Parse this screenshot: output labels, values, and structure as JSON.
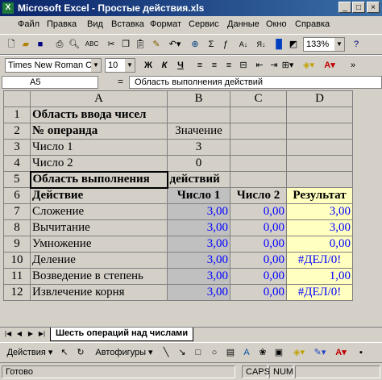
{
  "window": {
    "title": "Microsoft Excel - Простые действия.xls",
    "icon": "X",
    "buttons": [
      "_",
      "□",
      "×"
    ]
  },
  "menu": [
    "Файл",
    "Правка",
    "Вид",
    "Вставка",
    "Формат",
    "Сервис",
    "Данные",
    "Окно",
    "Справка"
  ],
  "standard_toolbar": {
    "zoom": "133%"
  },
  "format_toolbar": {
    "font": "Times New Roman Cyr",
    "size": "10",
    "bold": "Ж",
    "italic": "К",
    "underline": "Ч"
  },
  "formula_bar": {
    "cell": "A5",
    "fx": "=",
    "content": "Область выполнения действий"
  },
  "columns": [
    "A",
    "B",
    "C",
    "D"
  ],
  "rows": [
    {
      "n": "1",
      "a": "Область ввода чисел",
      "b": "",
      "c": "",
      "d": ""
    },
    {
      "n": "2",
      "a": "№ операнда",
      "b": "Значение",
      "c": "",
      "d": ""
    },
    {
      "n": "3",
      "a": "Число 1",
      "b": "3",
      "c": "",
      "d": ""
    },
    {
      "n": "4",
      "a": "Число 2",
      "b": "0",
      "c": "",
      "d": ""
    },
    {
      "n": "5",
      "a": "Область выполнения",
      "b": "действий",
      "c": "",
      "d": ""
    },
    {
      "n": "6",
      "a": "Действие",
      "b": "Число 1",
      "c": "Число 2",
      "d": "Результат"
    },
    {
      "n": "7",
      "a": "Сложение",
      "b": "3,00",
      "c": "0,00",
      "d": "3,00"
    },
    {
      "n": "8",
      "a": "Вычитание",
      "b": "3,00",
      "c": "0,00",
      "d": "3,00"
    },
    {
      "n": "9",
      "a": "Умножение",
      "b": "3,00",
      "c": "0,00",
      "d": "0,00"
    },
    {
      "n": "10",
      "a": "Деление",
      "b": "3,00",
      "c": "0,00",
      "d": "#ДЕЛ/0!"
    },
    {
      "n": "11",
      "a": "Возведение в степень",
      "b": "3,00",
      "c": "0,00",
      "d": "1,00"
    },
    {
      "n": "12",
      "a": "Извлечение корня",
      "b": "3,00",
      "c": "0,00",
      "d": "#ДЕЛ/0!"
    }
  ],
  "sheet_tab": "Шесть операций над числами",
  "drawing_toolbar": {
    "actions": "Действия ▾",
    "autoshapes": "Автофигуры ▾"
  },
  "status": {
    "ready": "Готово",
    "caps": "CAPS",
    "num": "NUM"
  }
}
